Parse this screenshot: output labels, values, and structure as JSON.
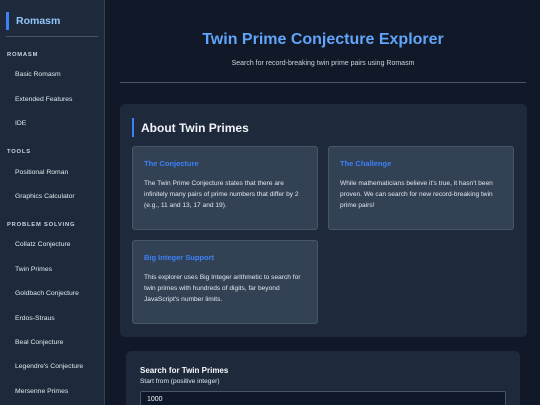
{
  "sidebar": {
    "brand": "Romasm",
    "sections": [
      {
        "title": "ROMASM",
        "items": [
          "Basic Romasm",
          "Extended Features",
          "IDE"
        ]
      },
      {
        "title": "TOOLS",
        "items": [
          "Positional Roman",
          "Graphics Calculator"
        ]
      },
      {
        "title": "PROBLEM SOLVING",
        "items": [
          "Collatz Conjecture",
          "Twin Primes",
          "Goldbach Conjecture",
          "Erdos-Straus",
          "Beal Conjecture",
          "Legendre's Conjecture",
          "Mersenne Primes"
        ]
      }
    ]
  },
  "header": {
    "title": "Twin Prime Conjecture Explorer",
    "subtitle": "Search for record-breaking twin prime pairs using Romasm"
  },
  "about": {
    "title": "About Twin Primes",
    "cards": [
      {
        "title": "The Conjecture",
        "lines": [
          "The Twin Prime Conjecture states that there are",
          "infinitely many pairs of prime numbers that differ by 2",
          "(e.g., 11 and 13, 17 and 19)."
        ]
      },
      {
        "title": "The Challenge",
        "lines": [
          "While mathematicians believe it's true, it hasn't been",
          "proven. We can search for new record-breaking twin",
          "prime pairs!"
        ]
      },
      {
        "title": "Big Integer Support",
        "lines": [
          "This explorer uses Big Integer arithmetic to search for",
          "twin primes with hundreds of digits, far beyond",
          "JavaScript's number limits."
        ]
      }
    ]
  },
  "search": {
    "title": "Search for Twin Primes",
    "start_label": "Start from (positive integer)",
    "start_value": "1000"
  },
  "colors": {
    "accent": "#3b82f6",
    "title": "#60a5fa",
    "panel": "#1e293b",
    "card": "#334155"
  }
}
